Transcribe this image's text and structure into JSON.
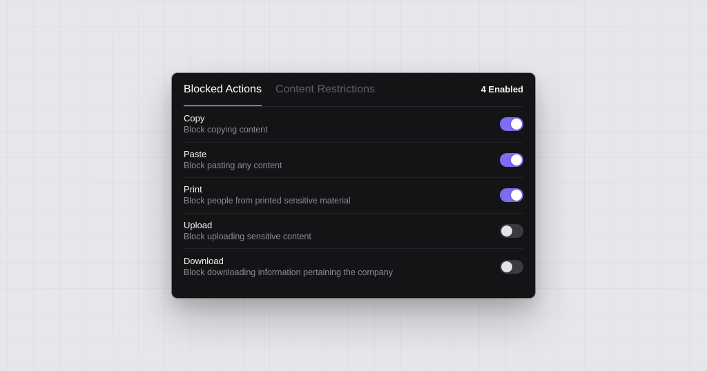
{
  "tabs": [
    {
      "label": "Blocked Actions",
      "active": true
    },
    {
      "label": "Content Restrictions",
      "active": false
    }
  ],
  "enabled_count": "4 Enabled",
  "colors": {
    "accent": "#7c6cf0",
    "panel_bg": "#141416",
    "toggle_off": "#3a3a40"
  },
  "actions": [
    {
      "title": "Copy",
      "description": "Block copying content",
      "enabled": true
    },
    {
      "title": "Paste",
      "description": "Block pasting any content",
      "enabled": true
    },
    {
      "title": "Print",
      "description": "Block people from printed sensitive material",
      "enabled": true
    },
    {
      "title": "Upload",
      "description": "Block uploading sensitive content",
      "enabled": false
    },
    {
      "title": "Download",
      "description": "Block downloading information pertaining the company",
      "enabled": false
    }
  ]
}
